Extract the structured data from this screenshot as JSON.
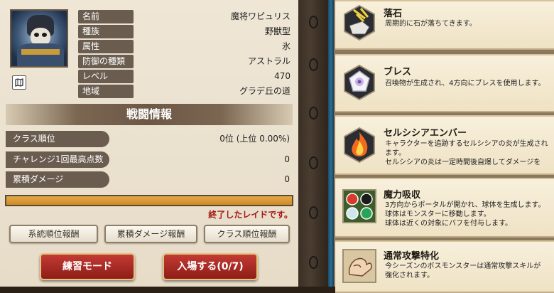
{
  "monster": {
    "rows": [
      {
        "label": "名前",
        "value": "魔将ワピュリス"
      },
      {
        "label": "種族",
        "value": "野獣型"
      },
      {
        "label": "属性",
        "value": "氷"
      },
      {
        "label": "防御の種類",
        "value": "アストラル"
      },
      {
        "label": "レベル",
        "value": "470"
      },
      {
        "label": "地域",
        "value": "グラデ丘の道"
      }
    ]
  },
  "battle": {
    "header": "戦闘情報",
    "stats": [
      {
        "label": "クラス順位",
        "value": "0位 (上位 0.00%)"
      },
      {
        "label": "チャレンジ1回最高点数",
        "value": "0"
      },
      {
        "label": "累積ダメージ",
        "value": "0"
      }
    ],
    "progress": 1.0,
    "status": "終了したレイドです。",
    "reward_buttons": [
      "系統順位報酬",
      "累積ダメージ報酬",
      "クラス順位報酬"
    ],
    "practice_label": "練習モード",
    "enter_label": "入場する(0/7)"
  },
  "skills": [
    {
      "icon": "falling-rock-icon",
      "title": "落石",
      "desc": [
        "周期的に石が落ちてきます。"
      ]
    },
    {
      "icon": "breath-icon",
      "title": "ブレス",
      "desc": [
        "召喚物が生成され、4方向にブレスを使用します。"
      ]
    },
    {
      "icon": "fire-ember-icon",
      "title": "セルシシアエンバー",
      "desc": [
        "キャラクターを追跡するセルシシアの炎が生成され",
        "ます。",
        "セルシシアの炎は一定時間後自爆してダメージを"
      ]
    },
    {
      "icon": "mana-absorb-icon",
      "title": "魔力吸収",
      "desc": [
        "3方向からポータルが開かれ、球体を生成します。",
        "球体はモンスターに移動します。",
        "球体は近くの対象にバフを付与します。"
      ]
    },
    {
      "icon": "attack-boost-icon",
      "title": "通常攻撃特化",
      "desc": [
        "今シーズンのボスモンスターは通常攻撃スキルが",
        "強化されます。"
      ]
    }
  ],
  "colors": {
    "accent_red": "#a11a16",
    "label_bg": "#6a5d50",
    "progress_fill": "#e5a948"
  }
}
